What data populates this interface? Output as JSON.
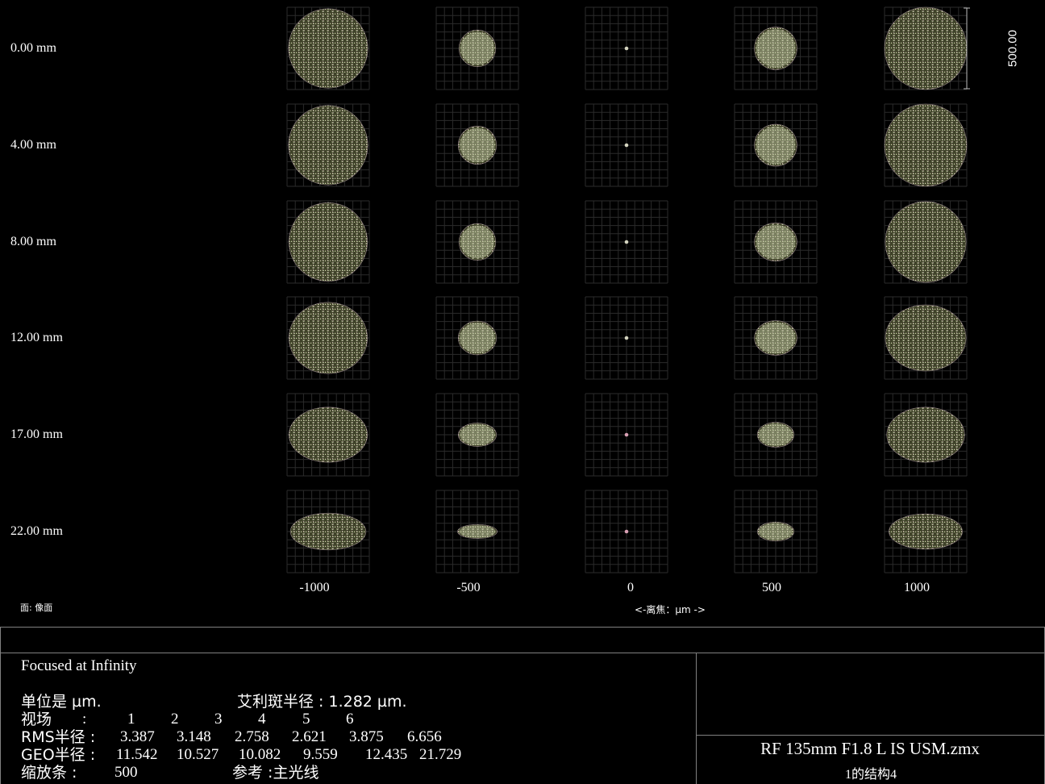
{
  "chart_data": {
    "type": "scatter",
    "title": "",
    "xlabel": "<-离焦：µm ->",
    "surface_label": "面: 像面",
    "scale_bar_label": "500.00",
    "defocus_um": [
      -1000,
      -500,
      0,
      500,
      1000
    ],
    "defocus_labels": [
      "-1000",
      "-500",
      "0",
      "500",
      "1000"
    ],
    "fields": [
      "0.00 mm",
      "4.00 mm",
      "8.00 mm",
      "12.00 mm",
      "17.00 mm",
      "22.00 mm"
    ],
    "spot_diameter_um": [
      [
        1080,
        500,
        30,
        580,
        1120
      ],
      [
        1080,
        520,
        30,
        580,
        1120
      ],
      [
        1070,
        500,
        30,
        580,
        1100
      ],
      [
        1070,
        520,
        30,
        580,
        1100
      ],
      [
        1070,
        520,
        30,
        500,
        1060
      ],
      [
        1030,
        540,
        40,
        500,
        1000
      ]
    ],
    "spot_height_um": [
      [
        1080,
        500,
        30,
        580,
        1120
      ],
      [
        1080,
        520,
        30,
        570,
        1120
      ],
      [
        1070,
        500,
        30,
        520,
        1100
      ],
      [
        970,
        460,
        30,
        470,
        900
      ],
      [
        750,
        320,
        30,
        340,
        750
      ],
      [
        500,
        190,
        30,
        260,
        480
      ]
    ],
    "colors": {
      "spot": "#c4c9a3",
      "spot_edge": "#b7a1a8",
      "grid": "#2b2b2b"
    }
  },
  "info": {
    "subtitle": "Focused at Infinity",
    "units": "单位是 µm.",
    "airy": "艾利斑半径 : 1.282 µm.",
    "field_label": "视场",
    "colon": ":",
    "field_numbers": [
      "1",
      "2",
      "3",
      "4",
      "5",
      "6"
    ],
    "rms_label": "RMS半径 :",
    "rms": [
      "3.387",
      "3.148",
      "2.758",
      "2.621",
      "3.875",
      "6.656"
    ],
    "geo_label": "GEO半径 :",
    "geo": [
      "11.542",
      "10.527",
      "10.082",
      "9.559",
      "12.435",
      "21.729"
    ],
    "scale_label": "缩放条 :",
    "scale_value": "500",
    "reference": "参考 :主光线",
    "file_name": "RF 135mm F1.8 L IS USM.zmx",
    "configuration": "1的结构4"
  }
}
